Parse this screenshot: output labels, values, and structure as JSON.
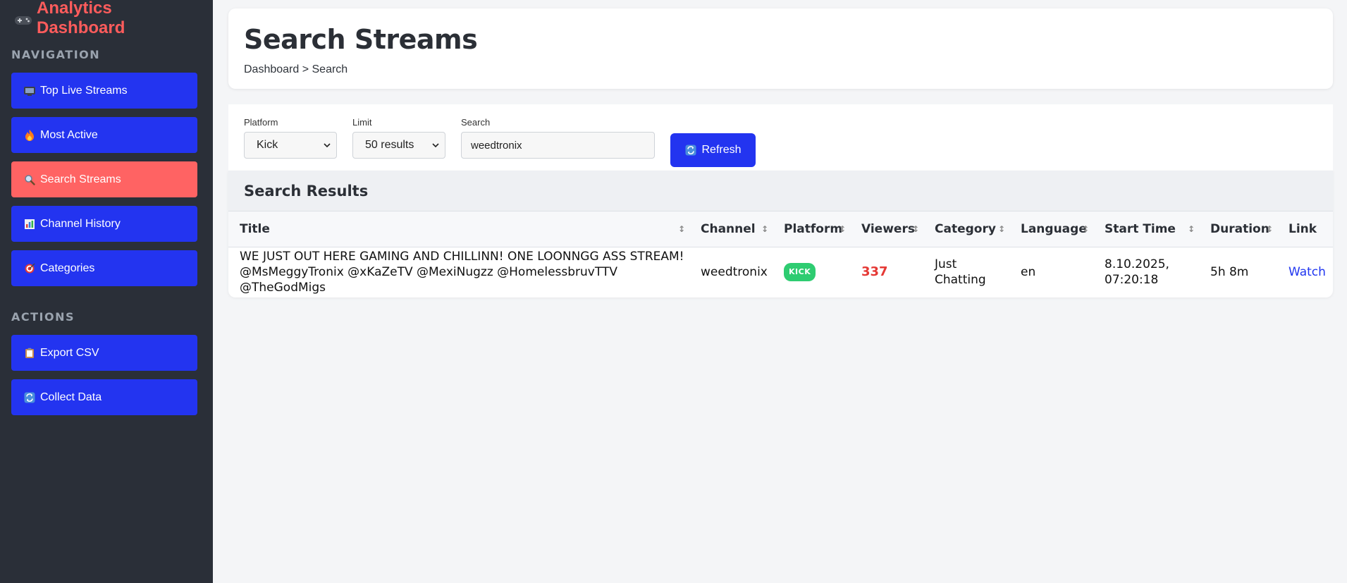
{
  "sidebar": {
    "brand": "Analytics Dashboard",
    "navigation_title": "NAVIGATION",
    "nav_items": [
      {
        "label": "Top Live Streams",
        "icon": "tv-icon"
      },
      {
        "label": "Most Active",
        "icon": "fire-icon"
      },
      {
        "label": "Search Streams",
        "icon": "magnifier-icon",
        "active": true
      },
      {
        "label": "Channel History",
        "icon": "bar-chart-icon"
      },
      {
        "label": "Categories",
        "icon": "target-icon"
      }
    ],
    "actions_title": "ACTIONS",
    "action_items": [
      {
        "label": "Export CSV",
        "icon": "clipboard-icon"
      },
      {
        "label": "Collect Data",
        "icon": "refresh-icon"
      }
    ]
  },
  "header": {
    "title": "Search Streams",
    "breadcrumb": "Dashboard > Search"
  },
  "filters": {
    "platform_label": "Platform",
    "platform_value": "Kick",
    "limit_label": "Limit",
    "limit_value": "50 results",
    "search_label": "Search",
    "search_value": "weedtronix",
    "refresh_label": "Refresh"
  },
  "results": {
    "title": "Search Results",
    "columns": [
      "Title",
      "Channel",
      "Platform",
      "Viewers",
      "Category",
      "Language",
      "Start Time",
      "Duration",
      "Link"
    ],
    "rows": [
      {
        "title": "WE JUST OUT HERE GAMING AND CHILLINN! ONE LOONNGG ASS STREAM! @MsMeggyTronix @xKaZeTV @MexiNugzz @HomelessbruvTTV @TheGodMigs",
        "channel": "weedtronix",
        "platform": "KICK",
        "viewers": "337",
        "category": "Just Chatting",
        "language": "en",
        "start_time": "8.10.2025, 07:20:18",
        "duration": "5h 8m",
        "link": "Watch"
      }
    ]
  },
  "colors": {
    "sidebar_bg": "#2a2f38",
    "brand": "#ff5c5c",
    "primary": "#2334f0",
    "active": "#ff6363",
    "kick_badge": "#2ecc71",
    "viewers": "#e53935"
  }
}
